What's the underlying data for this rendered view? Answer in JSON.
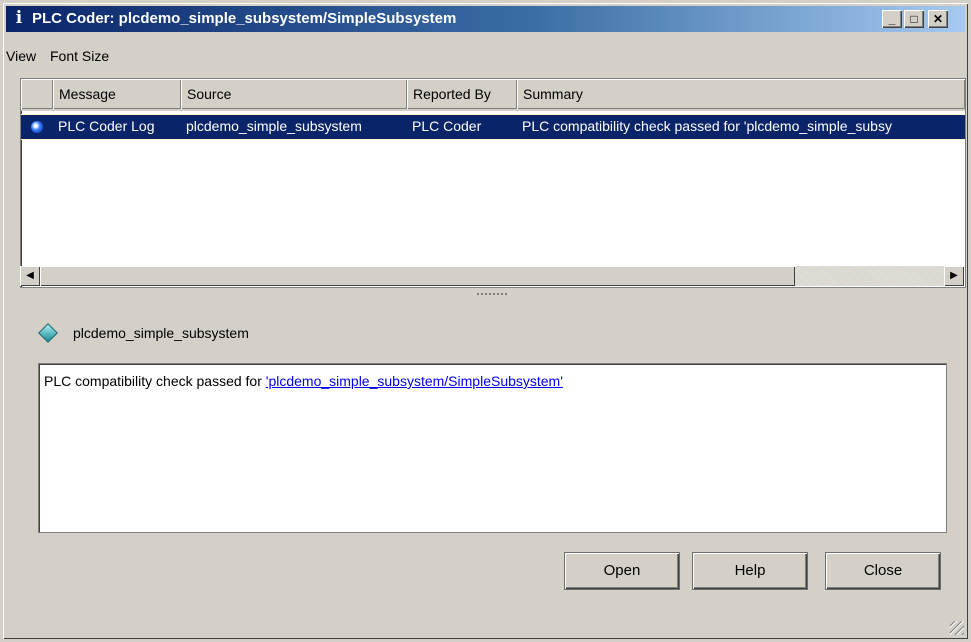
{
  "window": {
    "title": "PLC Coder: plcdemo_simple_subsystem/SimpleSubsystem"
  },
  "menu": [
    {
      "label": "View"
    },
    {
      "label": "Font Size"
    }
  ],
  "table": {
    "columns": [
      "Message",
      "Source",
      "Reported By",
      "Summary"
    ],
    "rows": [
      {
        "message": "PLC Coder Log",
        "source": "plcdemo_simple_subsystem",
        "reported_by": "PLC Coder",
        "summary": "PLC compatibility check passed for 'plcdemo_simple_subsy",
        "selected": true
      }
    ]
  },
  "detail": {
    "name": "plcdemo_simple_subsystem",
    "text_prefix": "PLC compatibility check passed for ",
    "link": "'plcdemo_simple_subsystem/SimpleSubsystem'"
  },
  "buttons": {
    "open": "Open",
    "help": "Help",
    "close": "Close"
  },
  "colors": {
    "selection": "#0a246a",
    "titlebar_start": "#0a246a",
    "link": "#0000ee"
  }
}
